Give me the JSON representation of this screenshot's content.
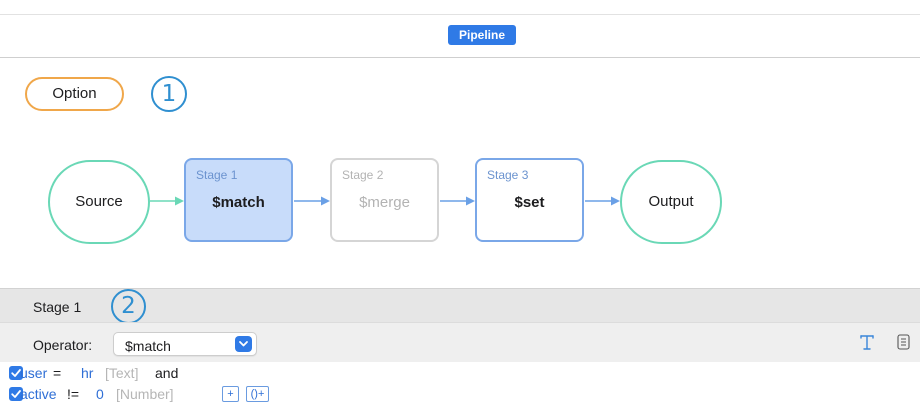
{
  "header": {
    "tab_label": "Pipeline"
  },
  "canvas": {
    "option_label": "Option",
    "callout_1": "1",
    "source_label": "Source",
    "output_label": "Output",
    "stages": [
      {
        "label": "Stage 1",
        "operator": "$match",
        "state": "selected"
      },
      {
        "label": "Stage 2",
        "operator": "$merge",
        "state": "disabled"
      },
      {
        "label": "Stage 3",
        "operator": "$set",
        "state": "enabled"
      }
    ]
  },
  "stage_panel": {
    "title": "Stage 1",
    "callout_2": "2",
    "operator_label": "Operator:",
    "operator_value": "$match"
  },
  "conditions": [
    {
      "checked": true,
      "field": "user",
      "operator": "=",
      "value": "hr",
      "type": "[Text]",
      "conjunction": "and"
    },
    {
      "checked": true,
      "field": "active",
      "operator": "!=",
      "value": "0",
      "type": "[Number]",
      "add_label": "+",
      "add_group_label": "()+"
    }
  ],
  "colors": {
    "accent": "#2f7ae6",
    "io_node_border": "#6ad8b6",
    "option_border": "#f0a74a",
    "callout": "#2f8fd0",
    "stage_selected_fill": "#c8dcfa"
  },
  "icons": {
    "tool_1": "text-format-icon",
    "tool_2": "document-icon",
    "checkbox": "checkmark-icon",
    "dropdown": "chevron-down-icon"
  }
}
